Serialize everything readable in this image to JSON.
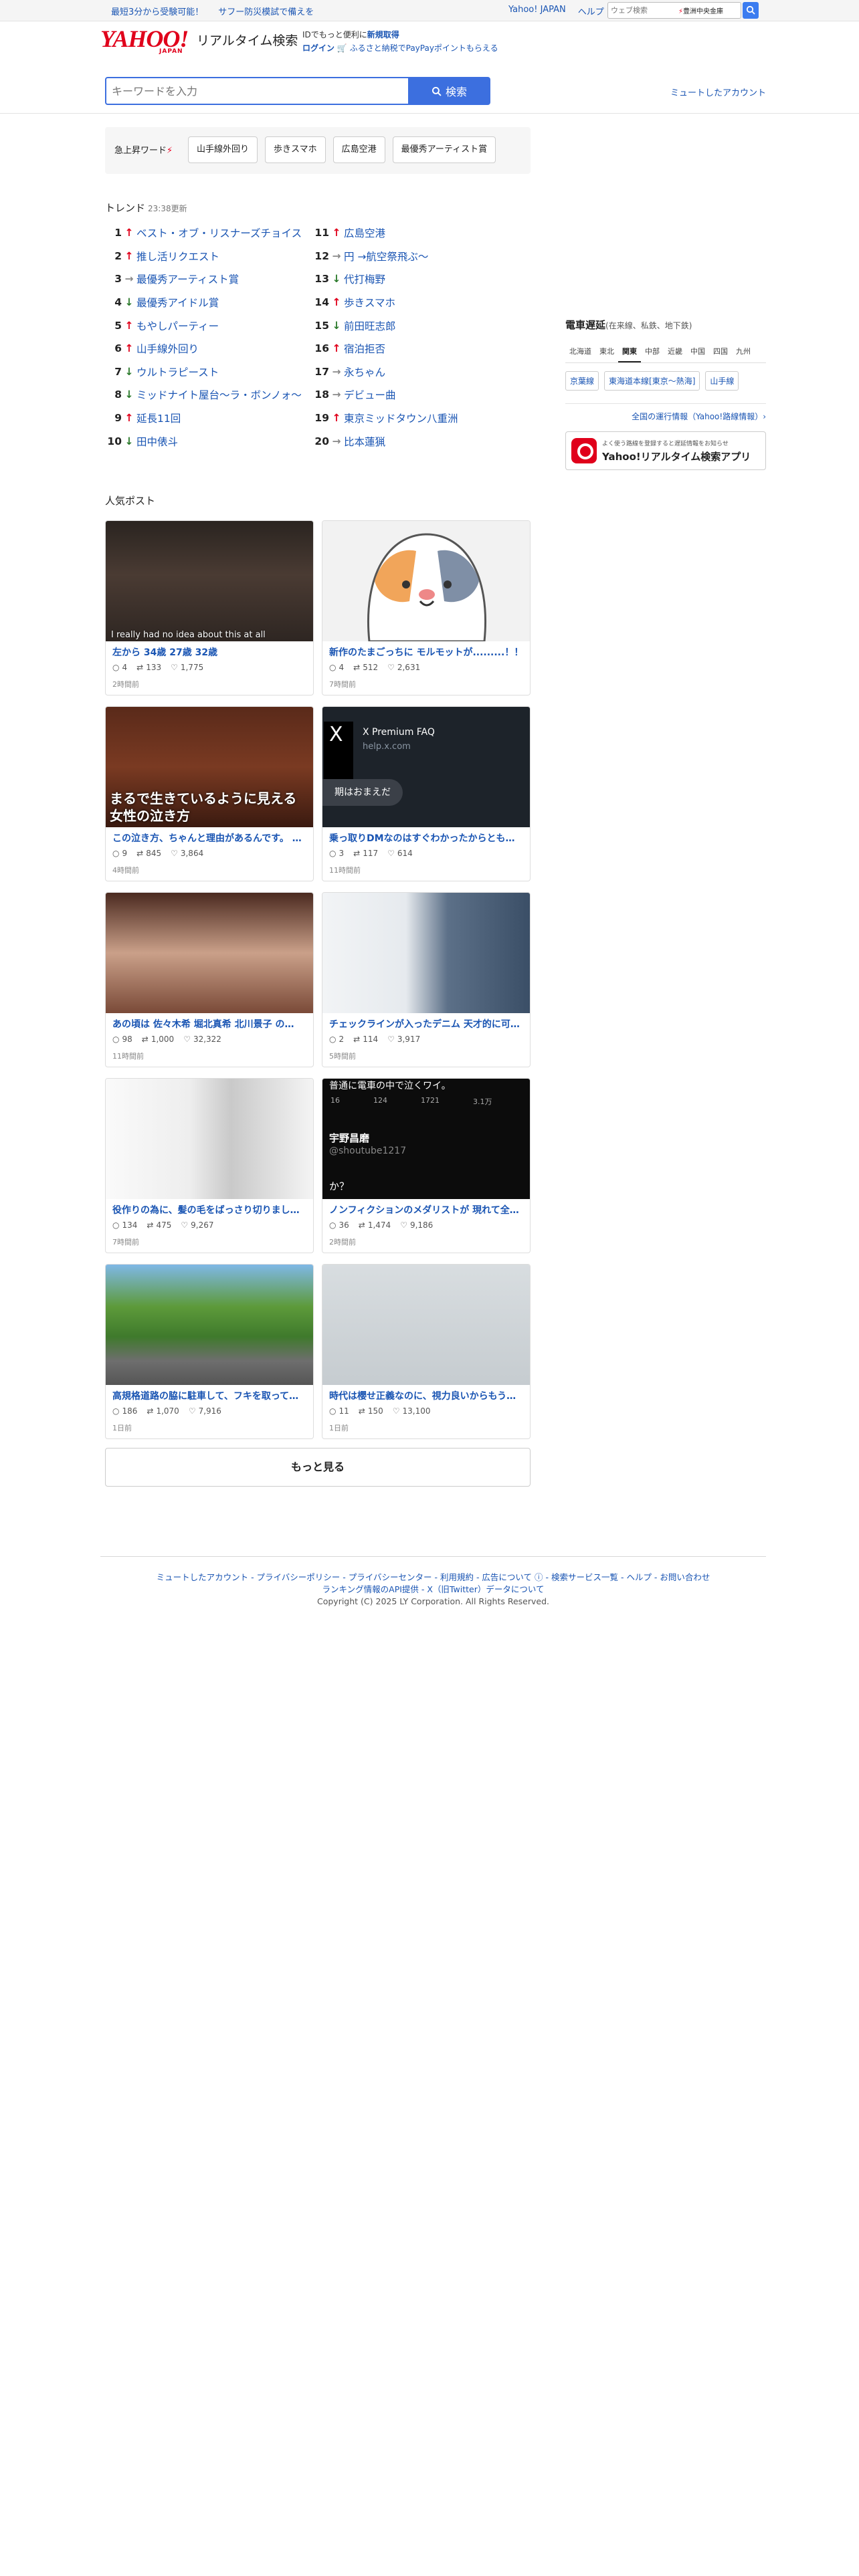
{
  "topbar": {
    "promo1": "最短3分から受験可能！",
    "promo2": "サフー防災模試で備えを",
    "yahoo_japan": "Yahoo! JAPAN",
    "help": "ヘルプ",
    "web_search_placeholder": "ウェブ検索",
    "hot_label": "豊洲中央金庫"
  },
  "header": {
    "logo_main": "YAHOO!",
    "logo_sub": "JAPAN",
    "service_name": "リアルタイム検索",
    "promo_line1_prefix": "IDでもっと便利に",
    "promo_line1_link": "新規取得",
    "promo_line2_login": "ログイン",
    "promo_line2_text": "ふるさと納税でPayPayポイントもらえる",
    "search_placeholder": "キーワードを入力",
    "search_button": "検索",
    "muted_accounts": "ミュートしたアカウント"
  },
  "rising": {
    "label": "急上昇ワード",
    "chips": [
      "山手線外回り",
      "歩きスマホ",
      "広島空港",
      "最優秀アーティスト賞"
    ]
  },
  "trend": {
    "title": "トレンド",
    "updated": "23:38更新",
    "left": [
      {
        "rank": "1",
        "dir": "up",
        "text": "ベスト・オブ・リスナーズチョイス"
      },
      {
        "rank": "2",
        "dir": "up",
        "text": "推し活リクエスト"
      },
      {
        "rank": "3",
        "dir": "same",
        "text": "最優秀アーティスト賞"
      },
      {
        "rank": "4",
        "dir": "down",
        "text": "最優秀アイドル賞"
      },
      {
        "rank": "5",
        "dir": "up",
        "text": "もやしパーティー"
      },
      {
        "rank": "6",
        "dir": "up",
        "text": "山手線外回り"
      },
      {
        "rank": "7",
        "dir": "down",
        "text": "ウルトラピースト"
      },
      {
        "rank": "8",
        "dir": "down",
        "text": "ミッドナイト屋台〜ラ・ボンノォ〜"
      },
      {
        "rank": "9",
        "dir": "up",
        "text": "延長11回"
      },
      {
        "rank": "10",
        "dir": "down",
        "text": "田中俵斗"
      }
    ],
    "right": [
      {
        "rank": "11",
        "dir": "up",
        "text": "広島空港"
      },
      {
        "rank": "12",
        "dir": "same",
        "text": "円 →航空祭飛ぶ〜"
      },
      {
        "rank": "13",
        "dir": "down",
        "text": "代打梅野"
      },
      {
        "rank": "14",
        "dir": "up",
        "text": "歩きスマホ"
      },
      {
        "rank": "15",
        "dir": "down",
        "text": "前田旺志郎"
      },
      {
        "rank": "16",
        "dir": "up",
        "text": "宿泊拒否"
      },
      {
        "rank": "17",
        "dir": "same",
        "text": "永ちゃん"
      },
      {
        "rank": "18",
        "dir": "same",
        "text": "デビュー曲"
      },
      {
        "rank": "19",
        "dir": "up",
        "text": "東京ミッドタウン八重洲"
      },
      {
        "rank": "20",
        "dir": "same",
        "text": "比本蓮猟"
      }
    ]
  },
  "train": {
    "title": "電車遅延",
    "subtitle": "(在来線、私鉄、地下鉄)",
    "regions": [
      "北海道",
      "東北",
      "関東",
      "中部",
      "近畿",
      "中国",
      "四国",
      "九州"
    ],
    "selected_region": "関東",
    "lines": [
      "京葉線",
      "東海道本線[東京〜熱海]",
      "山手線"
    ],
    "all_ops": "全国の運行情報（Yahoo!路線情報）›",
    "app_banner_line1": "よく使う路線を登録すると遅延情報をお知らせ",
    "app_banner_line2": "Yahoo!リアルタイム検索アプリ"
  },
  "popular": {
    "title": "人気ポスト",
    "cards": [
      {
        "title": "左から 34歳 27歳 32歳",
        "replies": "4",
        "reposts": "133",
        "likes": "1,775",
        "time": "2時間前",
        "caption": "I really had no idea about this at all"
      },
      {
        "title": "新作のたまごっちに モルモットが.........！！",
        "replies": "4",
        "reposts": "512",
        "likes": "2,631",
        "time": "7時間前",
        "caption": ""
      },
      {
        "title": "この泣き方、ちゃんと理由があるんです。 実は…",
        "replies": "9",
        "reposts": "845",
        "likes": "3,864",
        "time": "4時間前",
        "caption": "まるで生きているように見える 女性の泣き方"
      },
      {
        "title": "乗っ取りDMなのはすぐわかったからとも…",
        "replies": "3",
        "reposts": "117",
        "likes": "614",
        "time": "11時間前",
        "caption": "X Premium FAQ",
        "caption2": "help.x.com",
        "caption3": "期はおまえだ"
      },
      {
        "title": "あの頃は 佐々木希 堀北真希 北川景子 の…",
        "replies": "98",
        "reposts": "1,000",
        "likes": "32,322",
        "time": "11時間前",
        "caption": ""
      },
      {
        "title": "チェックラインが入ったデニム 天才的に可…",
        "replies": "2",
        "reposts": "114",
        "likes": "3,917",
        "time": "5時間前",
        "caption": ""
      },
      {
        "title": "役作りの為に、髪の毛をばっさり切りまし…",
        "replies": "134",
        "reposts": "475",
        "likes": "9,267",
        "time": "7時間前",
        "caption": ""
      },
      {
        "title": "ノンフィクションのメダリストが 現れて全…",
        "replies": "36",
        "reposts": "1,474",
        "likes": "9,186",
        "time": "2時間前",
        "caption": "普通に電車の中で泣くワイ。",
        "caption2": "宇野昌磨",
        "caption3": "@shoutube1217",
        "caption4": "か？",
        "mini_stats": [
          "16",
          "124",
          "1721",
          "3.1万"
        ]
      },
      {
        "title": "高規格道路の脇に駐車して、フキを取って…",
        "replies": "186",
        "reposts": "1,070",
        "likes": "7,916",
        "time": "1日前",
        "caption": ""
      },
      {
        "title": "時代は櫻せ正義なのに、視力良いからもう…",
        "replies": "11",
        "reposts": "150",
        "likes": "13,100",
        "time": "1日前",
        "caption": ""
      }
    ],
    "more": "もっと見る"
  },
  "footer": {
    "links": "ミュートしたアカウント - プライバシーポリシー - プライバシーセンター - 利用規約 - 広告について ⓘ - 検索サービス一覧 - ヘルプ - お問い合わせ",
    "links2": "ランキング情報のAPI提供 - X（旧Twitter）データについて",
    "copyright": "Copyright (C) 2025 LY Corporation. All Rights Reserved."
  }
}
